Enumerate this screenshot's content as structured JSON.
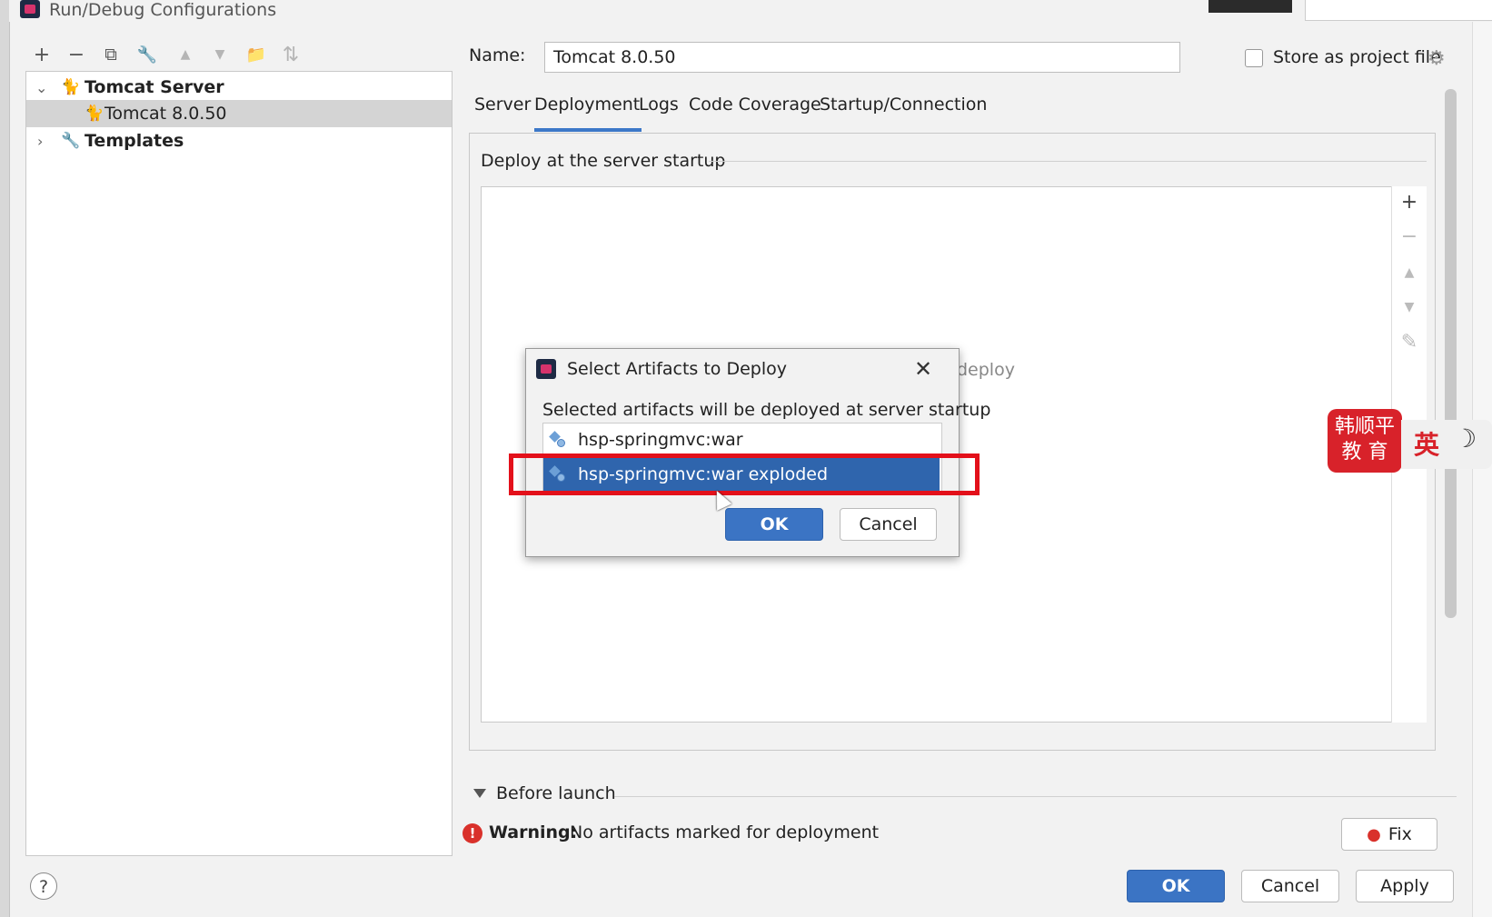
{
  "window": {
    "title": "Run/Debug Configurations"
  },
  "toolbar": {
    "add": "+",
    "remove": "−",
    "copy": "⧉",
    "edit": "🔧",
    "move_up": "▲",
    "move_down": "▼",
    "folder": "📁",
    "sort": "⇅"
  },
  "tree": {
    "items": [
      {
        "label": "Tomcat Server",
        "expanded": true,
        "icon": "tomcat-icon"
      },
      {
        "label": "Tomcat 8.0.50",
        "selected": true,
        "icon": "tomcat-icon"
      },
      {
        "label": "Templates",
        "expanded": false,
        "icon": "wrench-icon"
      }
    ]
  },
  "config": {
    "name_label": "Name:",
    "name_value": "Tomcat 8.0.50",
    "store_label": "Store as project file",
    "store_checked": false
  },
  "tabs": [
    "Server",
    "Deployment",
    "Logs",
    "Code Coverage",
    "Startup/Connection"
  ],
  "active_tab": "Deployment",
  "deploy": {
    "section_label": "Deploy at the server startup",
    "empty_text": "deploy",
    "tools": {
      "add": "+",
      "remove": "−",
      "up": "▲",
      "down": "▼",
      "edit": "✎"
    }
  },
  "before_launch": {
    "label": "Before launch"
  },
  "warning": {
    "strong": "Warning:",
    "text": "No artifacts marked for deployment"
  },
  "buttons": {
    "fix": "Fix",
    "ok": "OK",
    "cancel": "Cancel",
    "apply": "Apply",
    "help": "?"
  },
  "modal": {
    "title": "Select Artifacts to Deploy",
    "close": "✕",
    "description": "Selected artifacts will be deployed at server startup",
    "artifacts": [
      {
        "label": "hsp-springmvc:war",
        "selected": false
      },
      {
        "label": "hsp-springmvc:war exploded",
        "selected": true
      }
    ],
    "ok": "OK",
    "cancel": "Cancel"
  },
  "ime": {
    "brand_line1": "韩顺平",
    "brand_line2": "教 育",
    "mode": "英",
    "moon": "☽"
  },
  "colors": {
    "accent": "#3b74c4",
    "selection": "#2f65ad",
    "highlight": "#e3101a",
    "warning": "#d9312b"
  }
}
